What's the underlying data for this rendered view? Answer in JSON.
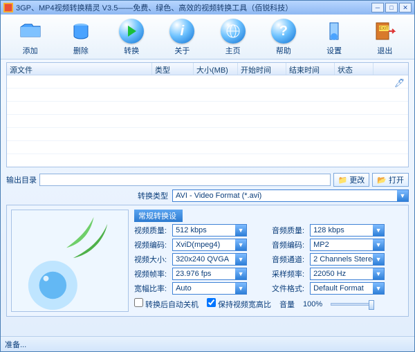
{
  "titlebar": {
    "text": "3GP、MP4视频转换精灵 V3.5——免费、绿色、高效的视频转换工具（佰锐科技）"
  },
  "toolbar": {
    "add": "添加",
    "remove": "删除",
    "convert": "转换",
    "about": "关于",
    "home": "主页",
    "help": "帮助",
    "settings": "设置",
    "exit": "退出"
  },
  "table": {
    "headers": {
      "source": "源文件",
      "type": "类型",
      "size": "大小(MB)",
      "start": "开始时间",
      "end": "结束时间",
      "status": "状态"
    }
  },
  "output": {
    "label": "输出目录",
    "value": "",
    "change": "更改",
    "open": "打开"
  },
  "params": {
    "tab": "常规转换设置",
    "type_label": "转换类型",
    "type_value": "AVI - Video Format (*.avi)",
    "vquality_label": "视频质量:",
    "vquality_value": "512 kbps",
    "aquality_label": "音频质量:",
    "aquality_value": "128 kbps",
    "vcodec_label": "视频编码:",
    "vcodec_value": "XviD(mpeg4)",
    "acodec_label": "音频编码:",
    "acodec_value": "MP2",
    "vsize_label": "视频大小:",
    "vsize_value": "320x240 QVGA",
    "achannel_label": "音频通道:",
    "achannel_value": "2 Channels Stereo",
    "vfps_label": "视频帧率:",
    "vfps_value": "23.976 fps",
    "arate_label": "采样频率:",
    "arate_value": "22050 Hz",
    "aspect_label": "宽幅比率:",
    "aspect_value": "Auto",
    "fformat_label": "文件格式:",
    "fformat_value": "Default Format",
    "shutdown": "转换后自动关机",
    "keepratio": "保持视频宽高比",
    "volume_label": "音量",
    "volume_value": "100%"
  },
  "status": {
    "text": "准备..."
  }
}
